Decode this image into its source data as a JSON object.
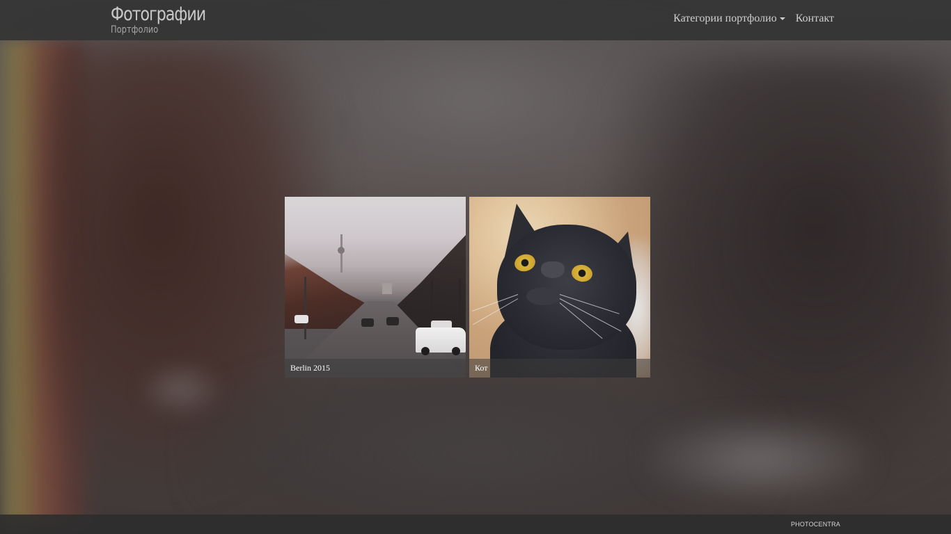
{
  "header": {
    "title": "Фотографии",
    "subtitle": "Портфолио",
    "nav": [
      {
        "label": "Категории портфолио",
        "has_dropdown": true
      },
      {
        "label": "Контакт",
        "has_dropdown": false
      }
    ]
  },
  "gallery": {
    "items": [
      {
        "caption": "Berlin 2015",
        "subject": "berlin-avenue-photo"
      },
      {
        "caption": "Кот",
        "subject": "black-cat-photo"
      }
    ]
  },
  "footer": {
    "credit": "PHOTOCENTRA"
  },
  "colors": {
    "header_bg": "#343434",
    "footer_bg": "#2e2e2e",
    "nav_text": "#cfcfcf",
    "caption_text": "#ffffff"
  }
}
